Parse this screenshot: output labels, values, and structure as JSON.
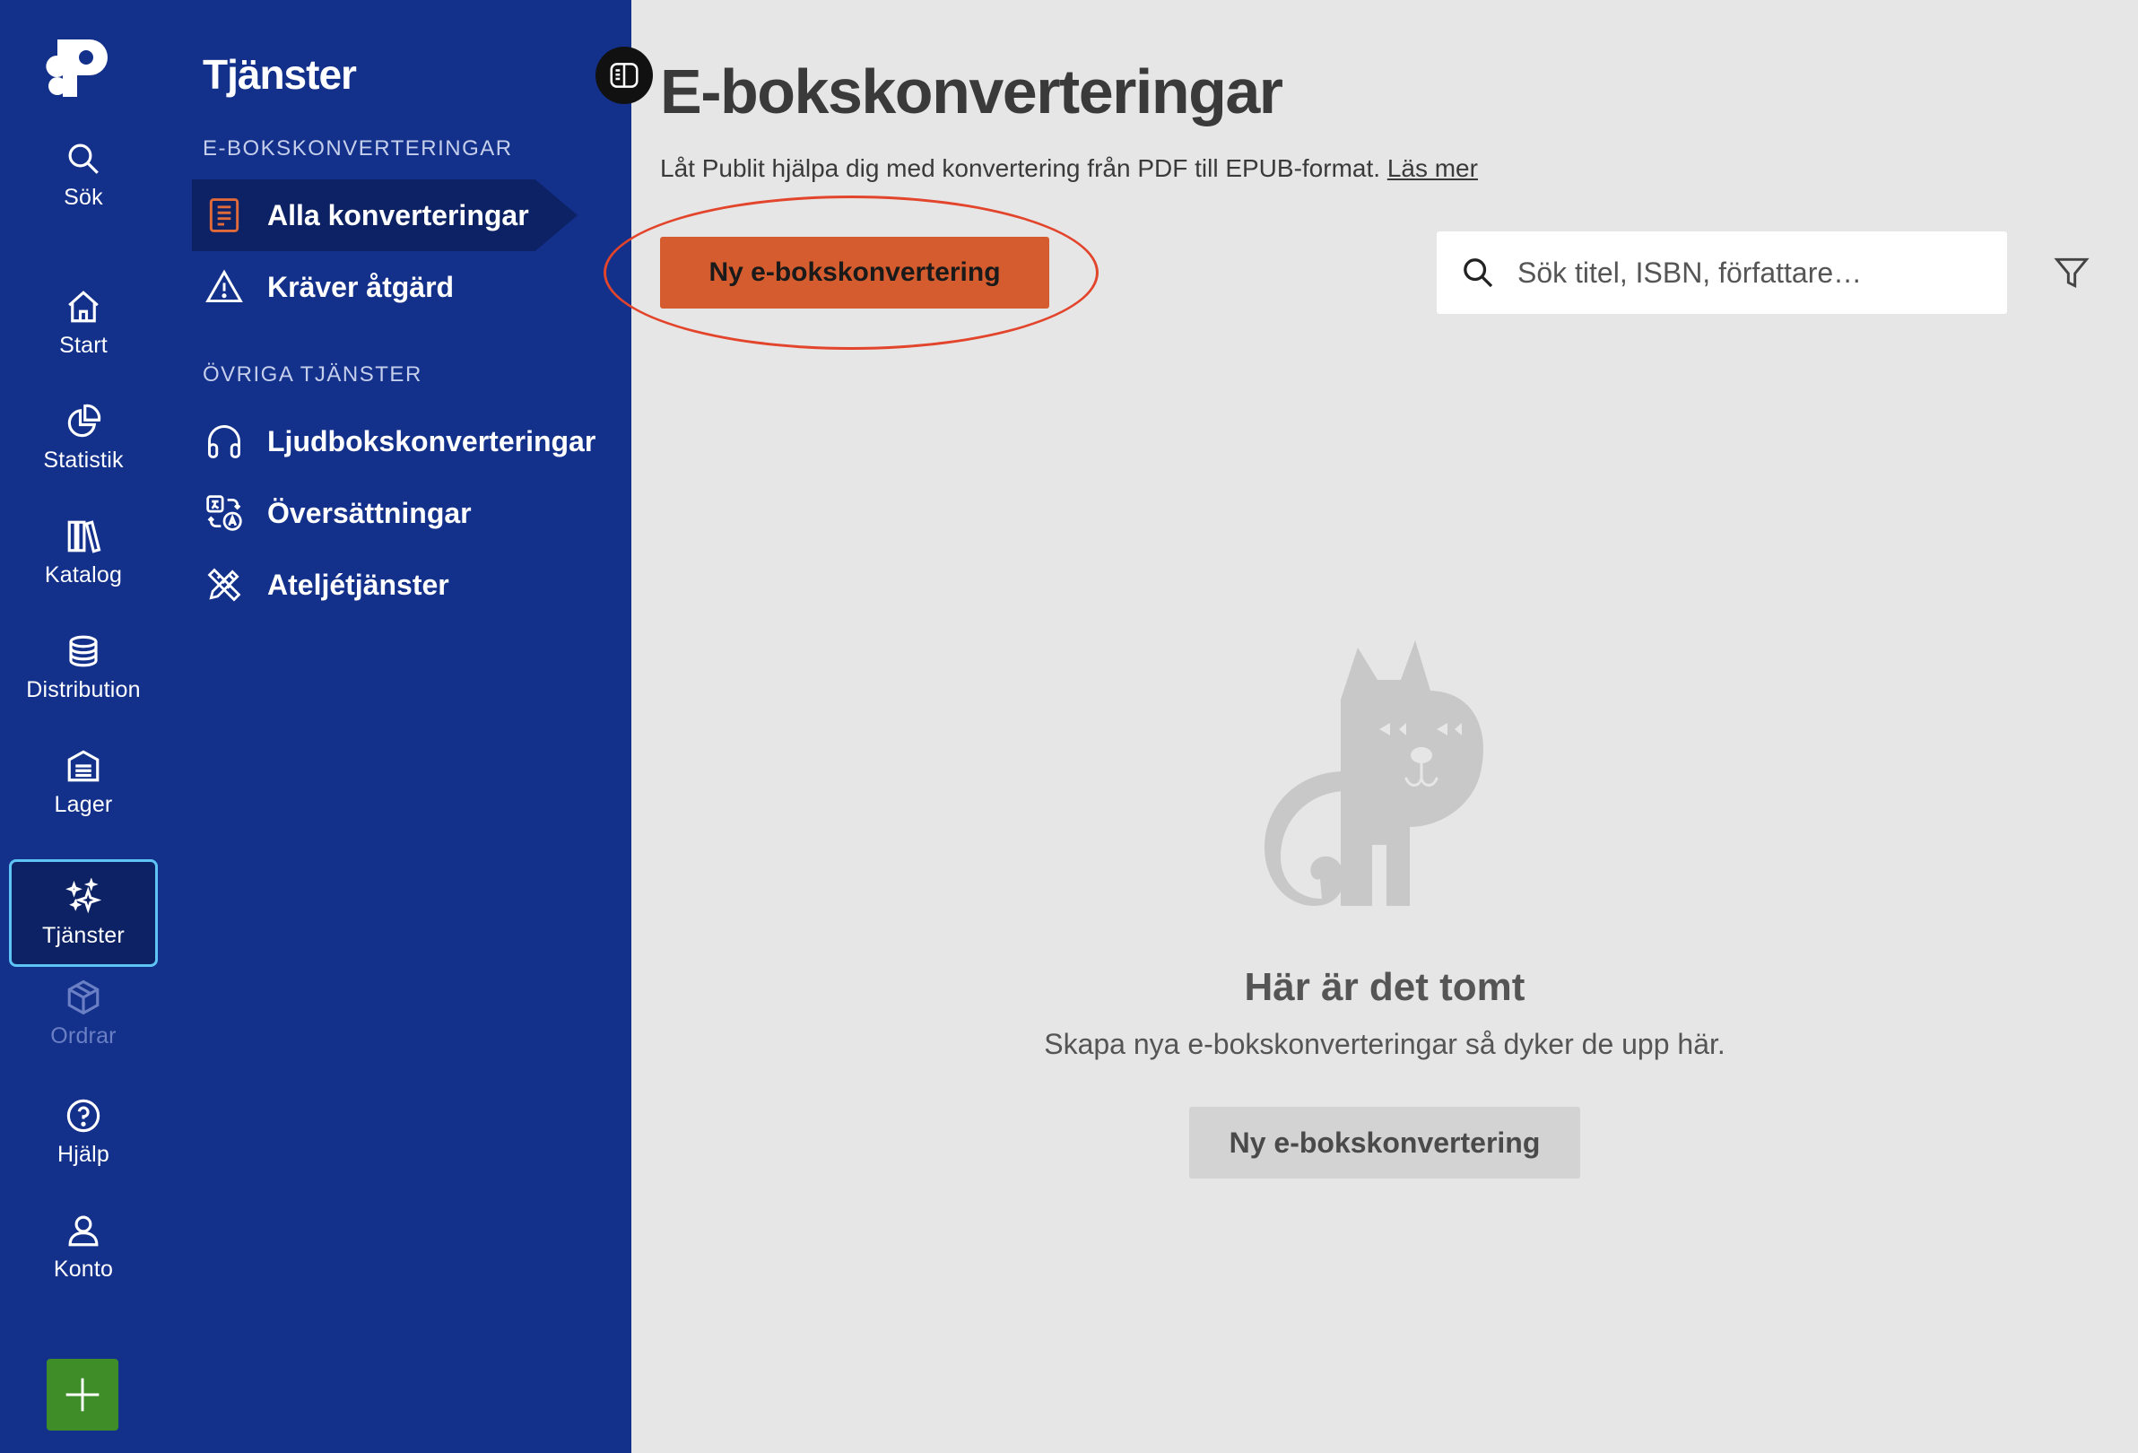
{
  "rail": {
    "items": [
      {
        "label": "Sök",
        "icon": "search-icon"
      },
      {
        "label": "Start",
        "icon": "home-icon"
      },
      {
        "label": "Statistik",
        "icon": "pie-chart-icon"
      },
      {
        "label": "Katalog",
        "icon": "books-icon"
      },
      {
        "label": "Distribution",
        "icon": "coins-stack-icon"
      },
      {
        "label": "Lager",
        "icon": "warehouse-icon"
      },
      {
        "label": "Tjänster",
        "icon": "sparkles-icon",
        "active": true
      },
      {
        "label": "Ordrar",
        "icon": "box-icon",
        "disabled": true
      },
      {
        "label": "Hjälp",
        "icon": "help-circle-icon"
      },
      {
        "label": "Konto",
        "icon": "user-icon"
      }
    ],
    "add_icon": "plus-icon"
  },
  "panel": {
    "title": "Tjänster",
    "section_ebook": "E-BOKSKONVERTERINGAR",
    "ebook_items": [
      {
        "label": "Alla konverteringar",
        "icon": "document-list-icon",
        "active": true
      },
      {
        "label": "Kräver åtgärd",
        "icon": "warning-triangle-icon"
      }
    ],
    "section_other": "ÖVRIGA TJÄNSTER",
    "other_items": [
      {
        "label": "Ljudbokskonverteringar",
        "icon": "headphones-icon"
      },
      {
        "label": "Översättningar",
        "icon": "translate-icon"
      },
      {
        "label": "Ateljétjänster",
        "icon": "pencil-ruler-icon"
      }
    ]
  },
  "main": {
    "title": "E-bokskonverteringar",
    "subtitle": "Låt Publit hjälpa dig med konvertering från PDF till EPUB-format.",
    "read_more": "Läs mer",
    "new_button": "Ny e-bokskonvertering",
    "search_placeholder": "Sök titel, ISBN, författare…",
    "empty_title": "Här är det tomt",
    "empty_text": "Skapa nya e-bokskonverteringar så dyker de upp här.",
    "empty_button": "Ny e-bokskonvertering"
  },
  "colors": {
    "sidebar": "#13308a",
    "accent_orange": "#d45c2e",
    "highlight_ring": "#e2452c",
    "add_green": "#3f8d29",
    "active_border": "#5ec4f5"
  }
}
